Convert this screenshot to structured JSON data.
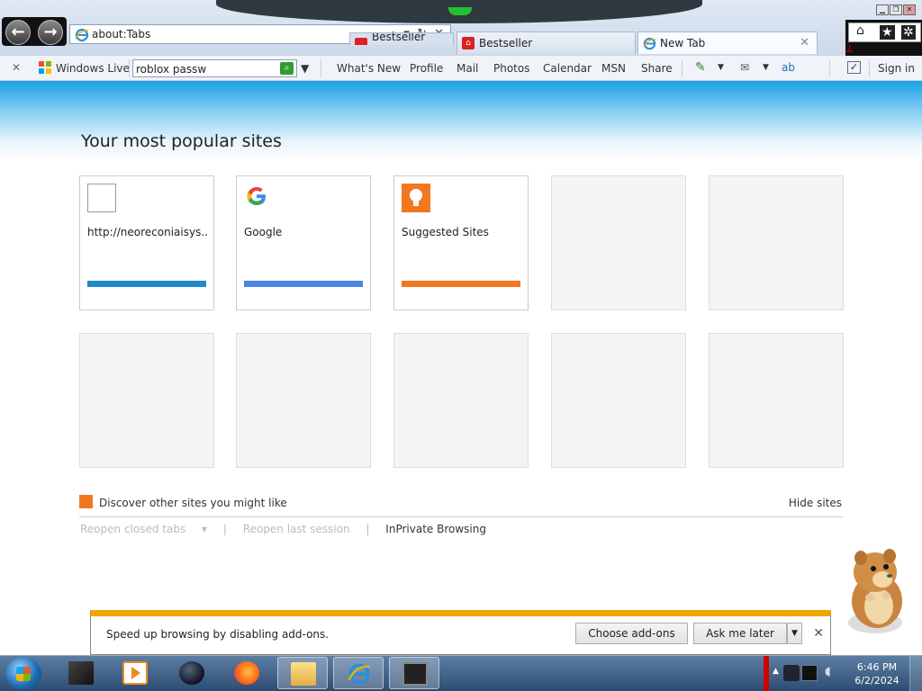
{
  "browser": {
    "address": "about:Tabs",
    "address_controls": "⌕ ▾ ↻ ✕",
    "tabs": [
      {
        "label": "Bestseller",
        "partial": true
      },
      {
        "label": "Bestseller"
      },
      {
        "label": "New Tab",
        "active": true
      }
    ],
    "window_controls": [
      "▁",
      "❐",
      "✕"
    ]
  },
  "commandbar": {
    "windows_live": "Windows Live",
    "search_value": "roblox passw",
    "links": [
      "What's New",
      "Profile",
      "Mail",
      "Photos",
      "Calendar",
      "MSN",
      "Share"
    ],
    "sign_in": "Sign in"
  },
  "newtab": {
    "title": "Your most popular sites",
    "tiles": [
      {
        "title": "http://neoreconiaisys....",
        "bar_color": "#1e8ac6",
        "icon": "blank-page-icon"
      },
      {
        "title": "Google",
        "bar_color": "#4a86e8",
        "icon": "google-icon"
      },
      {
        "title": "Suggested Sites",
        "bar_color": "#f27720",
        "icon": "suggested-sites-icon"
      },
      {
        "title": ""
      },
      {
        "title": ""
      },
      {
        "title": ""
      },
      {
        "title": ""
      },
      {
        "title": ""
      },
      {
        "title": ""
      },
      {
        "title": ""
      }
    ],
    "discover": "Discover other sites you might like",
    "hide_sites": "Hide sites",
    "reopen_closed": "Reopen closed tabs",
    "reopen_last": "Reopen last session",
    "inprivate": "InPrivate Browsing",
    "divider": "|"
  },
  "notification": {
    "message": "Speed up browsing by disabling add-ons.",
    "choose_label": "Choose add-ons",
    "later_label": "Ask me later"
  },
  "taskbar": {
    "time": "6:46 PM",
    "date": "6/2/2024"
  }
}
